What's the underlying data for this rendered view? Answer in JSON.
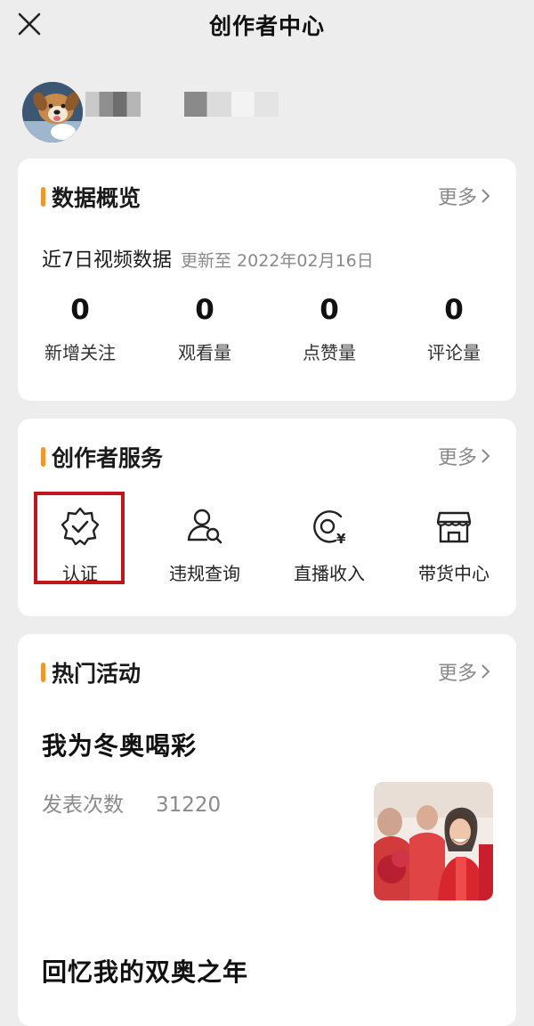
{
  "header": {
    "title": "创作者中心"
  },
  "data_overview": {
    "title": "数据概览",
    "more": "更多",
    "period": "近7日视频数据",
    "updated": "更新至 2022年02月16日",
    "stats": [
      {
        "value": "0",
        "label": "新增关注"
      },
      {
        "value": "0",
        "label": "观看量"
      },
      {
        "value": "0",
        "label": "点赞量"
      },
      {
        "value": "0",
        "label": "评论量"
      }
    ]
  },
  "creator_services": {
    "title": "创作者服务",
    "more": "更多",
    "items": [
      {
        "label": "认证",
        "icon": "verified-badge-icon"
      },
      {
        "label": "违规查询",
        "icon": "user-search-icon"
      },
      {
        "label": "直播收入",
        "icon": "live-income-icon"
      },
      {
        "label": "带货中心",
        "icon": "store-icon"
      }
    ]
  },
  "hot_activities": {
    "title": "热门活动",
    "more": "更多",
    "items": [
      {
        "title": "我为冬奥喝彩",
        "count_label": "发表次数",
        "count": "31220"
      },
      {
        "title": "回忆我的双奥之年"
      }
    ]
  },
  "colors": {
    "accent": "#f0962c",
    "highlight": "#c0161d",
    "background": "#ededed"
  }
}
